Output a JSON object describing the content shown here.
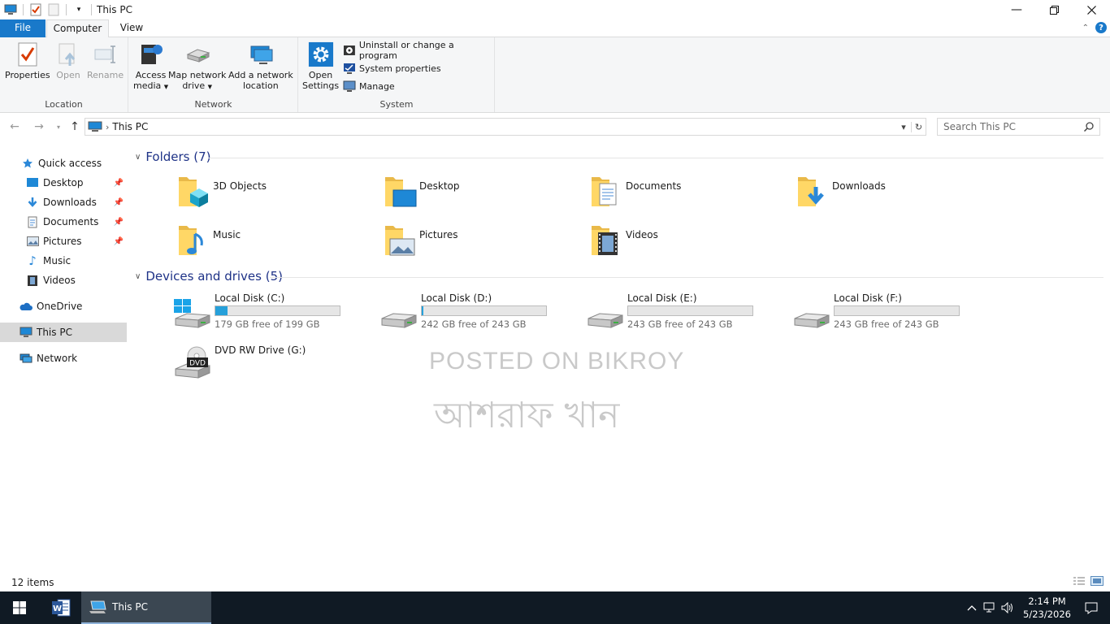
{
  "window": {
    "title": "This PC"
  },
  "ribbon_tabs": {
    "file": "File",
    "computer": "Computer",
    "view": "View"
  },
  "ribbon": {
    "location": {
      "label": "Location",
      "properties": "Properties",
      "open": "Open",
      "rename": "Rename"
    },
    "network": {
      "label": "Network",
      "access_media_1": "Access",
      "access_media_2": "media",
      "map_drive_1": "Map network",
      "map_drive_2": "drive",
      "add_location_1": "Add a network",
      "add_location_2": "location"
    },
    "system": {
      "label": "System",
      "open_settings_1": "Open",
      "open_settings_2": "Settings",
      "uninstall": "Uninstall or change a program",
      "system_properties": "System properties",
      "manage": "Manage"
    }
  },
  "address_bar": {
    "path": "This PC",
    "search_placeholder": "Search This PC"
  },
  "sidebar": {
    "quick_access": "Quick access",
    "items": [
      {
        "label": "Desktop"
      },
      {
        "label": "Downloads"
      },
      {
        "label": "Documents"
      },
      {
        "label": "Pictures"
      },
      {
        "label": "Music"
      },
      {
        "label": "Videos"
      }
    ],
    "onedrive": "OneDrive",
    "this_pc": "This PC",
    "network": "Network"
  },
  "folders": {
    "header": "Folders (7)",
    "items": [
      {
        "name": "3D Objects"
      },
      {
        "name": "Desktop"
      },
      {
        "name": "Documents"
      },
      {
        "name": "Downloads"
      },
      {
        "name": "Music"
      },
      {
        "name": "Pictures"
      },
      {
        "name": "Videos"
      }
    ]
  },
  "drives": {
    "header": "Devices and drives (5)",
    "items": [
      {
        "name": "Local Disk (C:)",
        "free": "179 GB free of 199 GB",
        "used_fraction": 0.1
      },
      {
        "name": "Local Disk (D:)",
        "free": "242 GB free of 243 GB",
        "used_fraction": 0.01
      },
      {
        "name": "Local Disk (E:)",
        "free": "243 GB free of 243 GB",
        "used_fraction": 0.0
      },
      {
        "name": "Local Disk (F:)",
        "free": "243 GB free of 243 GB",
        "used_fraction": 0.0
      },
      {
        "name": "DVD RW Drive (G:)",
        "dvd_label": "DVD"
      }
    ]
  },
  "watermark": {
    "line1": "POSTED ON BIKROY",
    "line2": "আশরাফ খান"
  },
  "status": {
    "item_count": "12 items"
  },
  "taskbar": {
    "active_app": "This PC",
    "time": "2:14 PM",
    "date": "5/23/2026"
  }
}
